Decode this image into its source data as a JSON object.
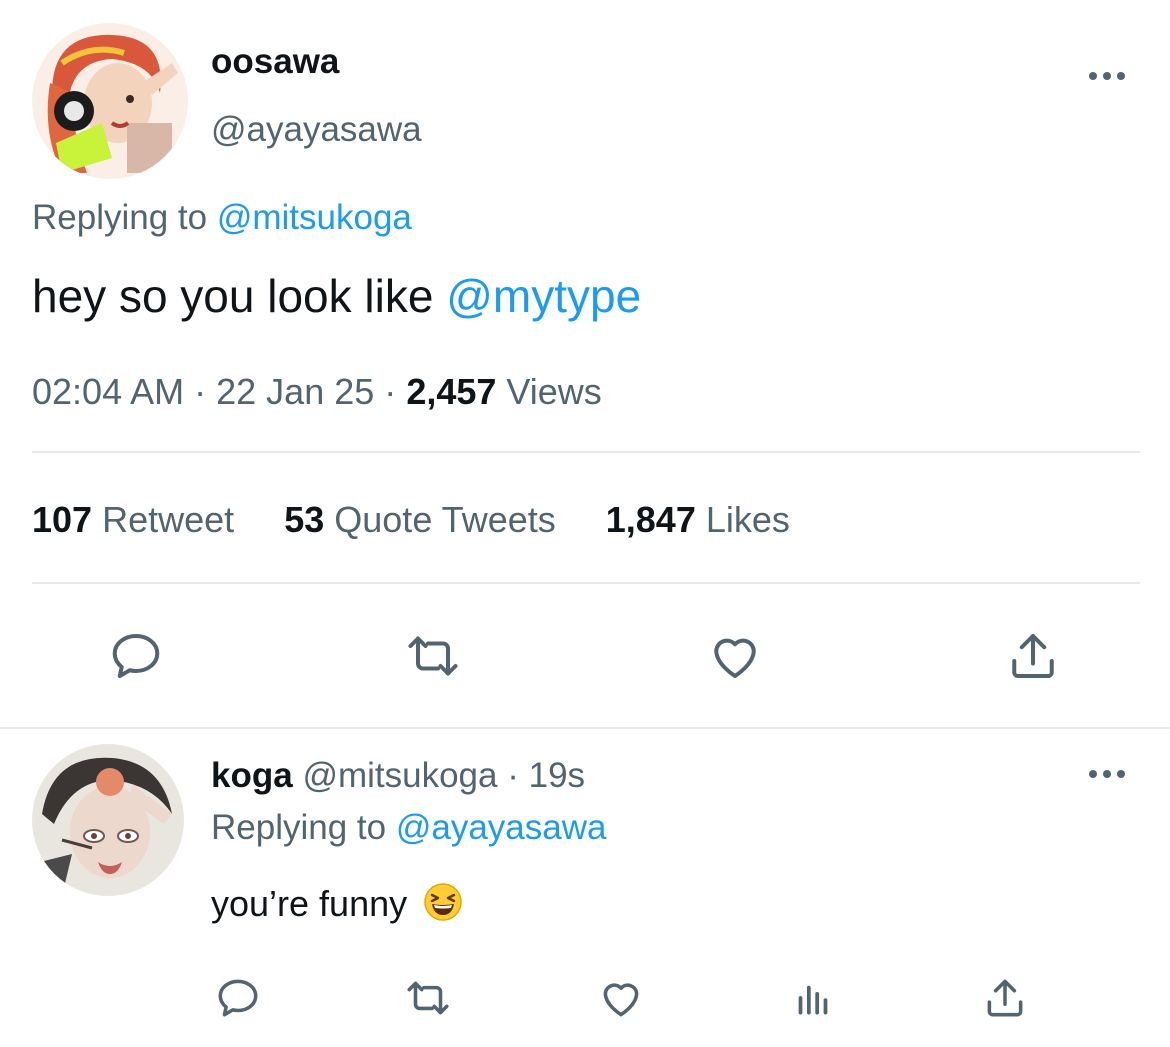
{
  "tweet": {
    "display_name": "oosawa",
    "handle": "@ayayasawa",
    "replying_prefix": "Replying to",
    "replying_handle": "@mitsukoga",
    "text": "hey so you look like",
    "mention": "@mytype",
    "time": "02:04 AM",
    "sep": "·",
    "date": "22 Jan 25",
    "views_count": "2,457",
    "views_label": "Views",
    "stats": {
      "retweets_count": "107",
      "retweets_label": "Retweet",
      "quotes_count": "53",
      "quotes_label": "Quote Tweets",
      "likes_count": "1,847",
      "likes_label": "Likes"
    },
    "actions": [
      "reply-icon",
      "retweet-icon",
      "like-icon",
      "share-icon"
    ]
  },
  "reply": {
    "display_name": "koga",
    "handle": "@mitsukoga",
    "sep": "·",
    "time_ago": "19s",
    "replying_prefix": "Replying to",
    "replying_handle": "@ayayasawa",
    "text": "you’re funny",
    "emoji": "grinning-squinting-face",
    "actions": [
      "reply-icon",
      "retweet-icon",
      "like-icon",
      "analytics-icon",
      "share-icon"
    ]
  },
  "colors": {
    "link": "#1d9bf0",
    "secondary_text": "#536471",
    "primary_text": "#0f1419",
    "divider": "#e6e9ec"
  }
}
